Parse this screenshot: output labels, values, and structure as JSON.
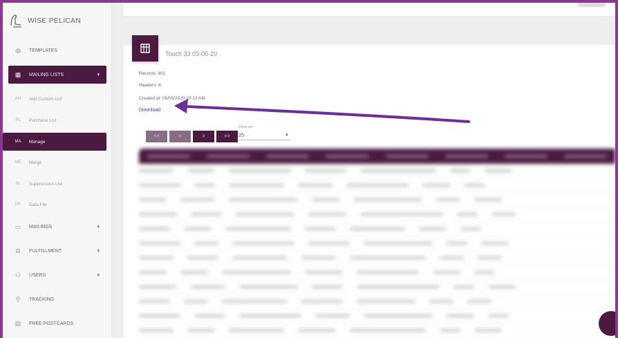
{
  "app": {
    "brand_name": "WISE PELICAN",
    "colors": {
      "accent": "#4a1a40",
      "frame": "#8a3a8c",
      "link": "#6a2a8c"
    }
  },
  "sidebar": {
    "items": [
      {
        "label": "TEMPLATES",
        "icon": "template-icon"
      },
      {
        "label": "MAILING LISTS",
        "icon": "table-icon",
        "active": true,
        "caret": "▾"
      },
      {
        "label": "Add Custom List",
        "icon_text": "AN",
        "sub": true
      },
      {
        "label": "Purchase List",
        "icon_text": "PL",
        "sub": true
      },
      {
        "label": "Manage",
        "icon_text": "MA",
        "sub": true,
        "active": true
      },
      {
        "label": "Merge",
        "icon_text": "ME",
        "sub": true
      },
      {
        "label": "Suppression List",
        "icon_text": "SL",
        "sub": true
      },
      {
        "label": "Data File",
        "icon_text": "DF",
        "sub": true
      },
      {
        "label": "MAILINGS",
        "icon": "mail-icon",
        "caret": "▾"
      },
      {
        "label": "FULFILLMENT",
        "icon": "package-icon",
        "caret": "▾"
      },
      {
        "label": "USERS",
        "icon": "users-icon",
        "caret": "▾"
      },
      {
        "label": "TRACKING",
        "icon": "pin-icon"
      },
      {
        "label": "FREE POSTCARDS",
        "icon": "postcard-icon"
      }
    ]
  },
  "list": {
    "title": "Touch 33 03-05-20",
    "records": "Records: 601",
    "headers": "Headers: 8",
    "created": "Created at: 05/05/2020 10:13 AM",
    "download_label": "Download"
  },
  "pager": {
    "first": "<<",
    "prev": "<",
    "next": ">",
    "last": ">>",
    "per_page_label": "Rows per",
    "per_page_value": "25"
  }
}
